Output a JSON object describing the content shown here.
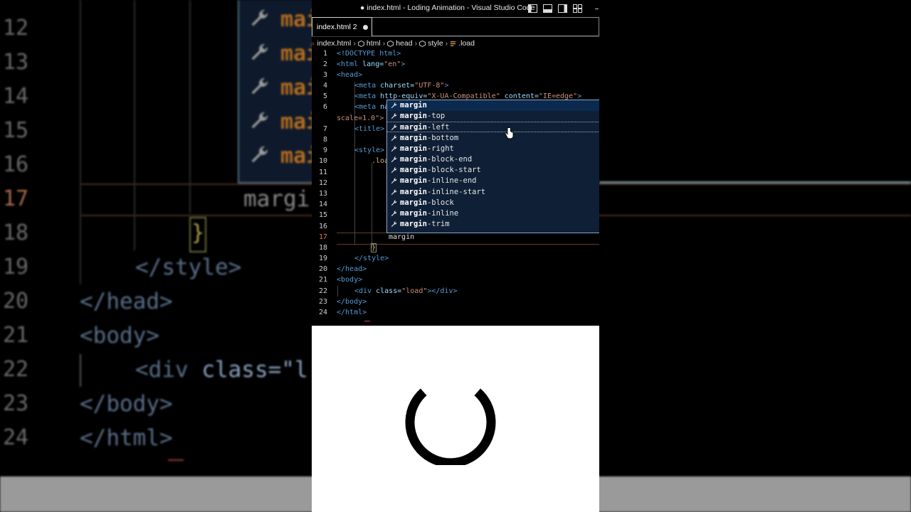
{
  "window": {
    "title": "● index.html - Loding Animation - Visual Studio Code",
    "minimize_glyph": "–"
  },
  "tab": {
    "label": "index.html 2"
  },
  "breadcrumb": [
    "index.html",
    "html",
    "head",
    "style",
    ".load"
  ],
  "suggestions": {
    "query": "margin",
    "items": [
      {
        "match": "margin",
        "rest": ""
      },
      {
        "match": "margin",
        "rest": "-top"
      },
      {
        "match": "margin",
        "rest": "-left"
      },
      {
        "match": "margin",
        "rest": "-bottom"
      },
      {
        "match": "margin",
        "rest": "-right"
      },
      {
        "match": "margin",
        "rest": "-block-end"
      },
      {
        "match": "margin",
        "rest": "-block-start"
      },
      {
        "match": "margin",
        "rest": "-inline-end"
      },
      {
        "match": "margin",
        "rest": "-inline-start"
      },
      {
        "match": "margin",
        "rest": "-block"
      },
      {
        "match": "margin",
        "rest": "-inline"
      },
      {
        "match": "margin",
        "rest": "-trim"
      }
    ]
  },
  "code": {
    "line_numbers": [
      "1",
      "2",
      "3",
      "4",
      "5",
      "6",
      "7",
      "8",
      "9",
      "10",
      "11",
      "12",
      "13",
      "14",
      "15",
      "16",
      "17",
      "18",
      "19",
      "20",
      "21",
      "22",
      "23",
      "24"
    ],
    "active_line": "17",
    "l1": "<!DOCTYPE html>",
    "l2_tag": "<html",
    "l2_attr": " lang=",
    "l2_val": "\"en\"",
    "l2_end": ">",
    "l3": "<head>",
    "l4_tag": "<meta",
    "l4_attr": " charset=",
    "l4_val": "\"UTF-8\"",
    "l4_end": ">",
    "l5_tag": "<meta",
    "l5_attr": " http-equiv=",
    "l5_val": "\"X-UA-Compatible\"",
    "l5_attr2": " content=",
    "l5_val2": "\"IE=edge\"",
    "l5_end": ">",
    "l6_tag": "<meta",
    "l6_attr": " na",
    "l6b": "scale=1.0\">",
    "l7_tag": "<title>",
    "l9_tag": "<style>",
    "l10": ".loa",
    "l17": "margin",
    "l18": "}",
    "l19": "</style>",
    "l20": "</head>",
    "l21": "<body>",
    "l22_tag": "<div",
    "l22_attr": " class=",
    "l22_val": "\"load\"",
    "l22_end": "></div>",
    "l23": "</body>",
    "l24": "</html>"
  },
  "background": {
    "line_numbers": [
      "12",
      "13",
      "14",
      "15",
      "16",
      "17",
      "18",
      "19",
      "20",
      "21",
      "22",
      "23",
      "24"
    ],
    "popup_item": "mai",
    "typed": "margi",
    "brace": "}",
    "l19": "</style>",
    "l20": "</head>",
    "l21": "<body>",
    "l22_tag": "<div",
    "l22_attr": " class=\"l",
    "l23": "</body>",
    "l24": "</html>"
  },
  "colors": {
    "editor_bg": "#000000",
    "suggest_bg": "#0f1f36",
    "suggest_border": "#8aa6c8",
    "tag": "#569cd6",
    "attribute": "#9cdcfe",
    "string": "#ce9178",
    "active_line_number": "#e07a4a",
    "preview_bg": "#ffffff",
    "spinner": "#000000"
  }
}
